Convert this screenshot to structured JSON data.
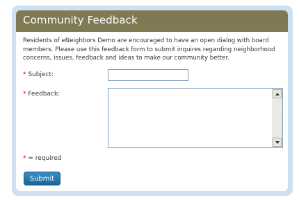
{
  "header": {
    "title": "Community Feedback"
  },
  "intro": {
    "text": "Residents of eNeighbors Demo are encouraged to have an open dialog with board members. Please use this feedback form to submit inquires regarding neighborhood concerns, issues, feedback and ideas to make our community better."
  },
  "form": {
    "subject": {
      "asterisk": "*",
      "label": "Subject:",
      "value": ""
    },
    "feedback": {
      "asterisk": "*",
      "label": "Feedback:",
      "value": ""
    },
    "required_note": {
      "asterisk": "*",
      "text": "= required"
    },
    "submit_label": "Submit"
  },
  "colors": {
    "header_bg": "#7f7a54",
    "frame_bg": "#cfe1f0",
    "required_marker": "#e00000",
    "button_bg": "#1f6fa6"
  }
}
